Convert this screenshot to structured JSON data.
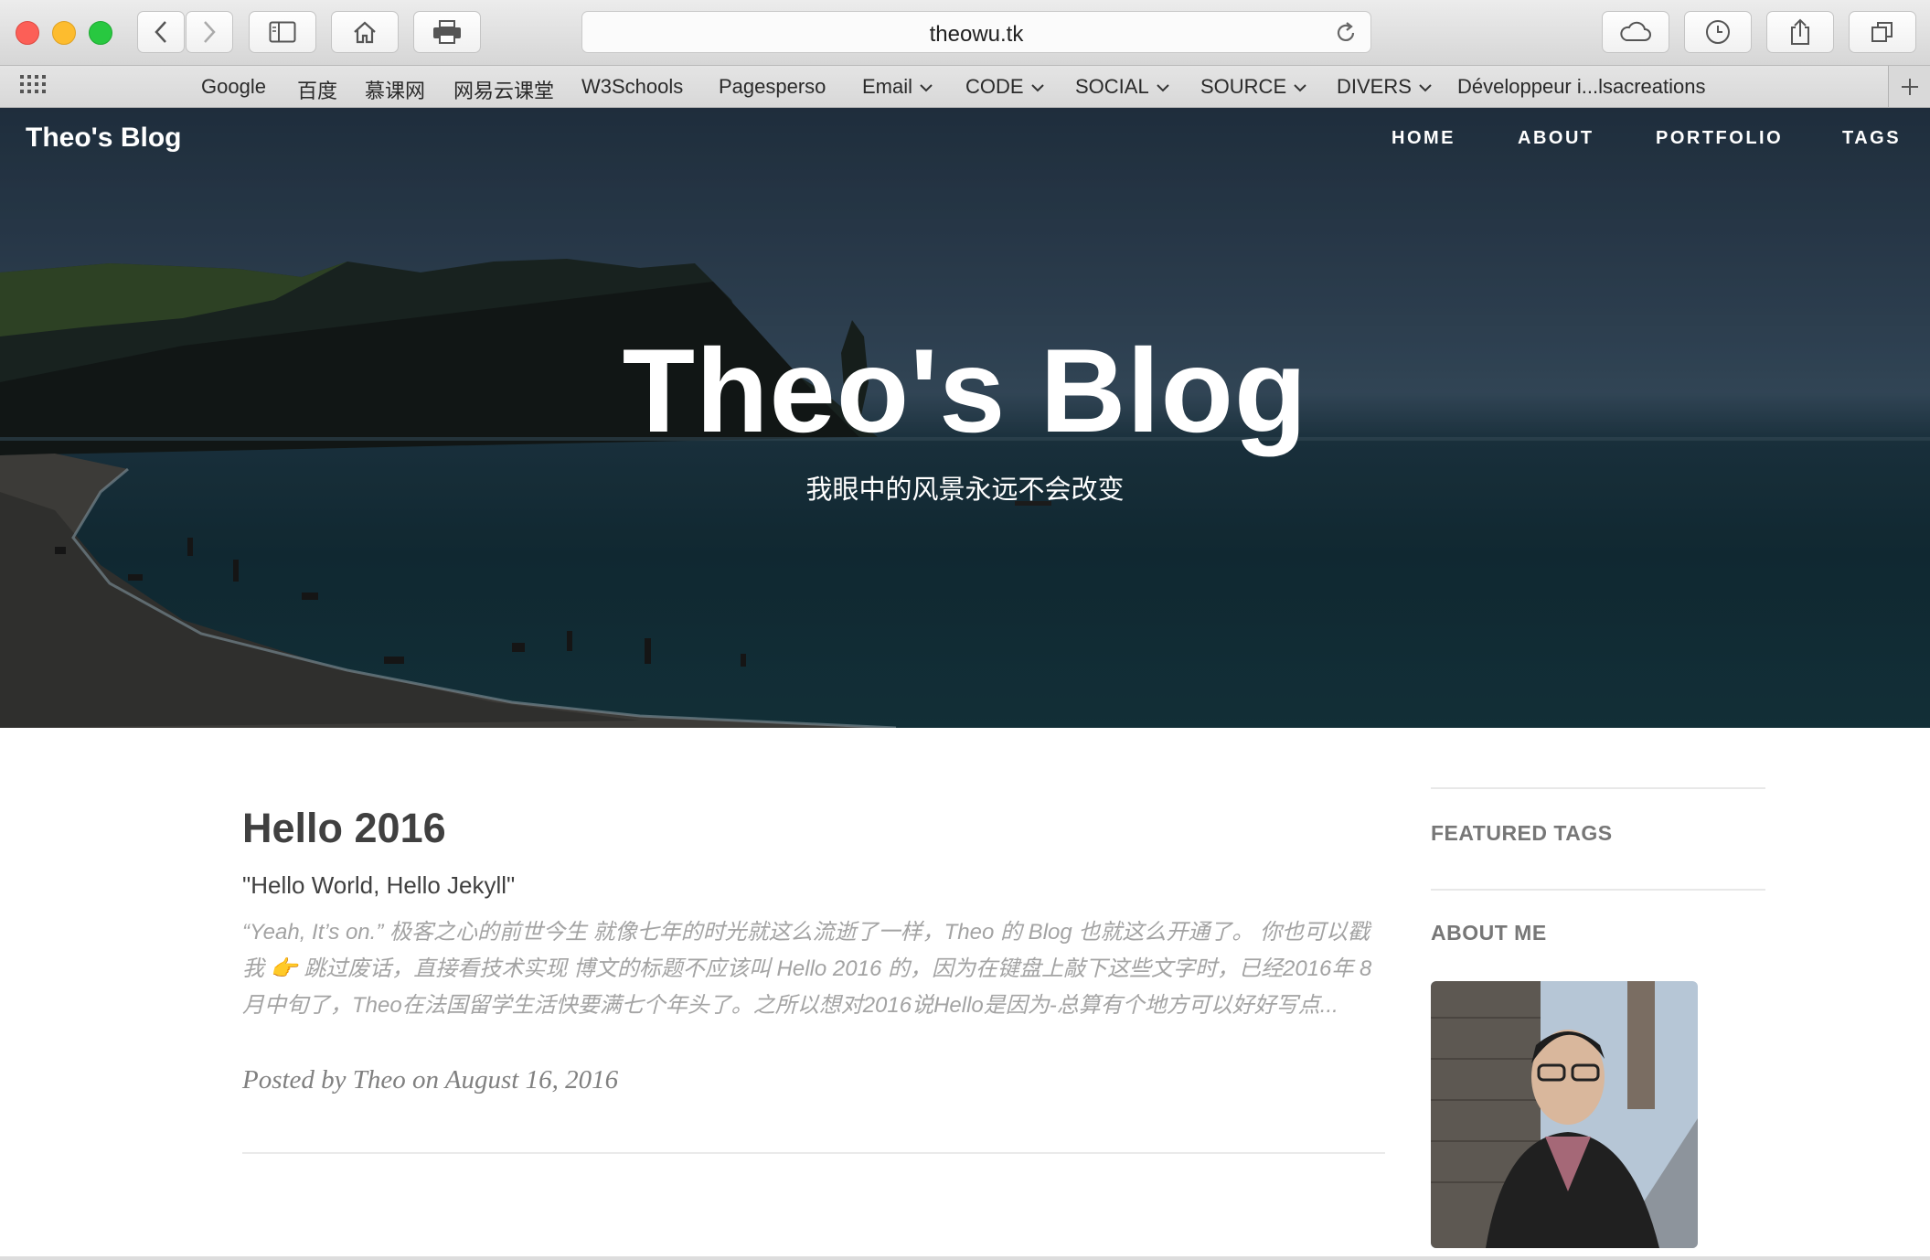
{
  "browser": {
    "url": "theowu.tk",
    "bookmarks": [
      "Google",
      "百度",
      "慕课网",
      "网易云课堂",
      "W3Schools",
      "Pagesperso",
      "Email",
      "CODE",
      "SOCIAL",
      "SOURCE",
      "DIVERS",
      "Développeur i...lsacreations"
    ]
  },
  "site": {
    "brand": "Theo's Blog",
    "nav": [
      "HOME",
      "ABOUT",
      "PORTFOLIO",
      "TAGS"
    ]
  },
  "hero": {
    "title": "Theo's Blog",
    "subtitle": "我眼中的风景永远不会改变"
  },
  "post": {
    "title": "Hello 2016",
    "subtitle": "\"Hello World, Hello Jekyll\"",
    "excerpt": "“Yeah, It’s on.” 极客之心的前世今生 就像七年的时光就这么流逝了一样，Theo 的 Blog 也就这么开通了。 你也可以戳我 👉 跳过废话，直接看技术实现 博文的标题不应该叫 Hello 2016 的，因为在键盘上敲下这些文字时，已经2016年 8月中旬了，Theo在法国留学生活快要满七个年头了。之所以想对2016说Hello是因为-总算有个地方可以好好写点...",
    "meta": "Posted by Theo on August 16, 2016"
  },
  "sidebar": {
    "featured_tags": "FEATURED TAGS",
    "about_me": "ABOUT ME"
  }
}
